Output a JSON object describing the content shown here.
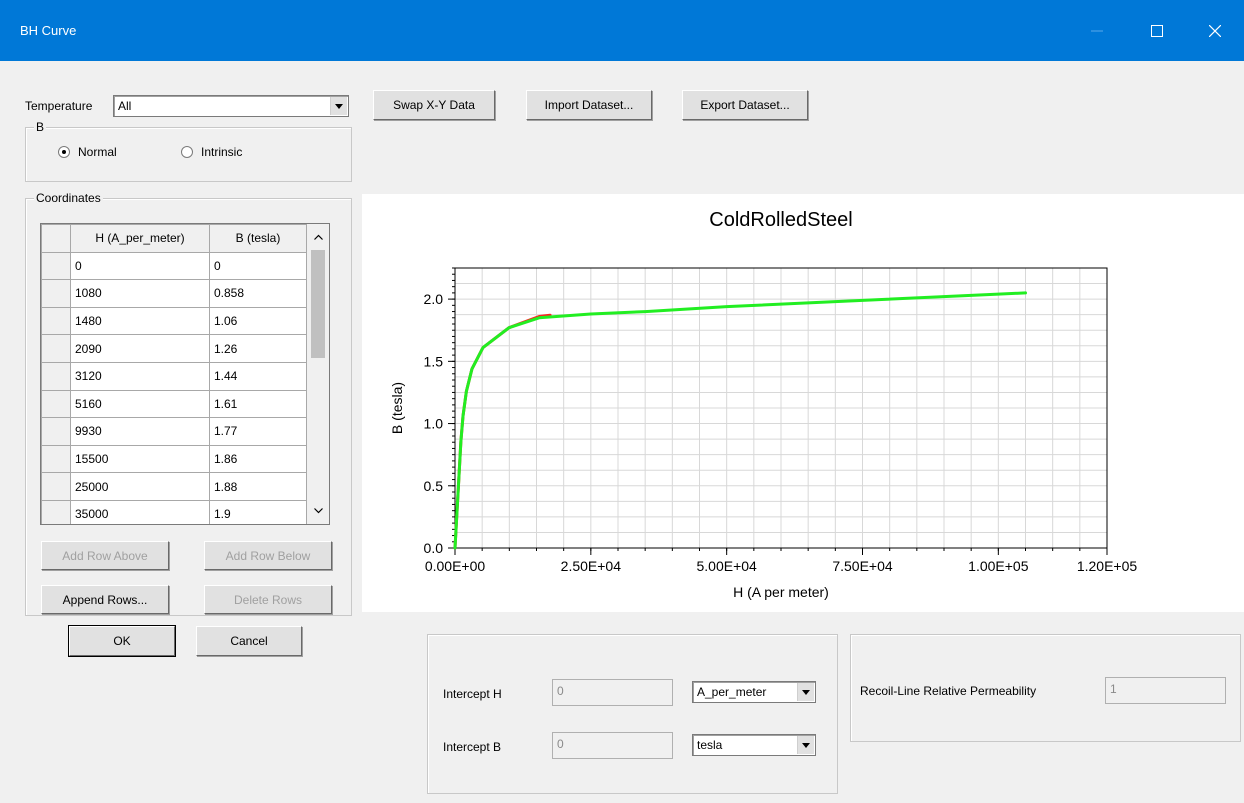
{
  "window": {
    "title": "BH Curve",
    "controls": [
      "minimize",
      "maximize",
      "close"
    ]
  },
  "temperature": {
    "label": "Temperature",
    "value": "All"
  },
  "b_group": {
    "legend": "B",
    "options": [
      {
        "label": "Normal",
        "selected": true
      },
      {
        "label": "Intrinsic",
        "selected": false
      }
    ]
  },
  "toolbar": {
    "swap_label": "Swap X-Y Data",
    "import_label": "Import Dataset...",
    "export_label": "Export Dataset..."
  },
  "coordinates": {
    "legend": "Coordinates",
    "columns": [
      "H (A_per_meter)",
      "B (tesla)"
    ],
    "rows": [
      [
        "0",
        "0"
      ],
      [
        "1080",
        "0.858"
      ],
      [
        "1480",
        "1.06"
      ],
      [
        "2090",
        "1.26"
      ],
      [
        "3120",
        "1.44"
      ],
      [
        "5160",
        "1.61"
      ],
      [
        "9930",
        "1.77"
      ],
      [
        "15500",
        "1.86"
      ],
      [
        "25000",
        "1.88"
      ],
      [
        "35000",
        "1.9"
      ]
    ],
    "add_above_label": "Add Row Above",
    "add_below_label": "Add Row Below",
    "append_label": "Append Rows...",
    "delete_label": "Delete Rows"
  },
  "dialog": {
    "ok_label": "OK",
    "cancel_label": "Cancel"
  },
  "intercept": {
    "h_label": "Intercept H",
    "h_value": "0",
    "h_unit": "A_per_meter",
    "b_label": "Intercept B",
    "b_value": "0",
    "b_unit": "tesla"
  },
  "recoil": {
    "label": "Recoil-Line Relative Permeability",
    "value": "1"
  },
  "chart_data": {
    "type": "line",
    "title": "ColdRolledSteel",
    "xlabel": "H (A  per meter)",
    "ylabel": "B (tesla)",
    "xlim": [
      0,
      120000
    ],
    "ylim": [
      0,
      2.25
    ],
    "x_tick_labels": [
      "0.00E+00",
      "2.50E+04",
      "5.00E+04",
      "7.50E+04",
      "1.00E+05",
      "1.20E+05"
    ],
    "x_tick_values": [
      0,
      25000,
      50000,
      75000,
      100000,
      120000
    ],
    "y_tick_labels": [
      "0.0",
      "0.5",
      "1.0",
      "1.5",
      "2.0"
    ],
    "y_tick_values": [
      0,
      0.5,
      1.0,
      1.5,
      2.0
    ],
    "grid": true,
    "series": [
      {
        "color": "#ff2020",
        "x": [
          0,
          1080,
          1480,
          2090,
          3120,
          5160,
          9930,
          15500,
          17500
        ],
        "y": [
          0,
          0.858,
          1.06,
          1.26,
          1.44,
          1.61,
          1.77,
          1.86,
          1.87
        ]
      },
      {
        "color": "#22ee22",
        "x": [
          0,
          1080,
          1480,
          2090,
          3120,
          5160,
          9930,
          15500,
          25000,
          35000,
          50000,
          75000,
          100000,
          105000
        ],
        "y": [
          0,
          0.858,
          1.06,
          1.26,
          1.44,
          1.61,
          1.77,
          1.85,
          1.88,
          1.9,
          1.94,
          1.99,
          2.04,
          2.05
        ]
      }
    ]
  }
}
